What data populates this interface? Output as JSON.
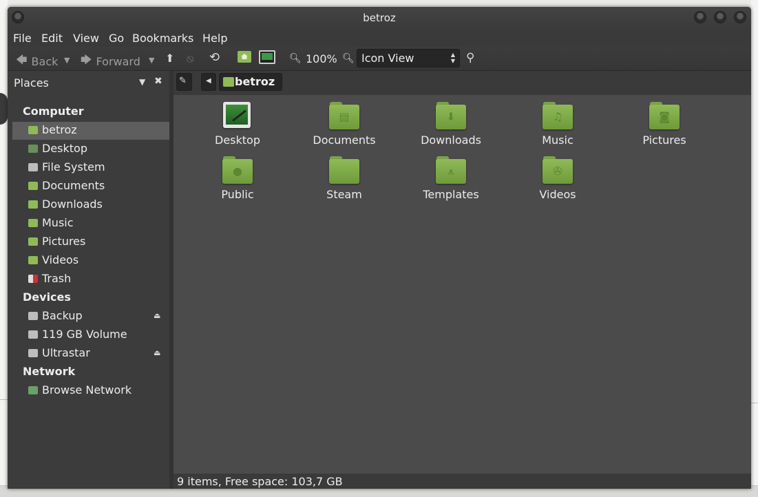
{
  "window": {
    "title": "betroz"
  },
  "menu": [
    "File",
    "Edit",
    "View",
    "Go",
    "Bookmarks",
    "Help"
  ],
  "toolbar": {
    "back": "Back",
    "forward": "Forward",
    "zoom": "100%",
    "view_mode": "Icon View"
  },
  "sidebar": {
    "title": "Places",
    "sections": [
      {
        "name": "Computer",
        "items": [
          {
            "label": "betroz",
            "icon": "home-folder-icon",
            "selected": true
          },
          {
            "label": "Desktop",
            "icon": "desktop-icon"
          },
          {
            "label": "File System",
            "icon": "drive-icon"
          },
          {
            "label": "Documents",
            "icon": "folder-icon"
          },
          {
            "label": "Downloads",
            "icon": "folder-icon"
          },
          {
            "label": "Music",
            "icon": "folder-icon"
          },
          {
            "label": "Pictures",
            "icon": "folder-icon"
          },
          {
            "label": "Videos",
            "icon": "folder-icon"
          },
          {
            "label": "Trash",
            "icon": "trash-icon"
          }
        ]
      },
      {
        "name": "Devices",
        "items": [
          {
            "label": "Backup",
            "icon": "drive-icon",
            "eject": true
          },
          {
            "label": "119 GB Volume",
            "icon": "drive-icon"
          },
          {
            "label": "Ultrastar",
            "icon": "drive-icon",
            "eject": true
          }
        ]
      },
      {
        "name": "Network",
        "items": [
          {
            "label": "Browse Network",
            "icon": "network-icon"
          }
        ]
      }
    ]
  },
  "pathbar": {
    "current": "betroz"
  },
  "files": [
    {
      "label": "Desktop",
      "icon": "desktop-icon"
    },
    {
      "label": "Documents",
      "icon": "folder-documents-icon"
    },
    {
      "label": "Downloads",
      "icon": "folder-downloads-icon"
    },
    {
      "label": "Music",
      "icon": "folder-music-icon"
    },
    {
      "label": "Pictures",
      "icon": "folder-pictures-icon"
    },
    {
      "label": "Public",
      "icon": "folder-public-icon"
    },
    {
      "label": "Steam",
      "icon": "folder-icon"
    },
    {
      "label": "Templates",
      "icon": "folder-templates-icon"
    },
    {
      "label": "Videos",
      "icon": "folder-videos-icon"
    }
  ],
  "status": "9 items, Free space: 103,7 GB",
  "colors": {
    "folder_green": "#8fba57",
    "selection": "#5e5e5e",
    "background": "#4b4b4b"
  }
}
